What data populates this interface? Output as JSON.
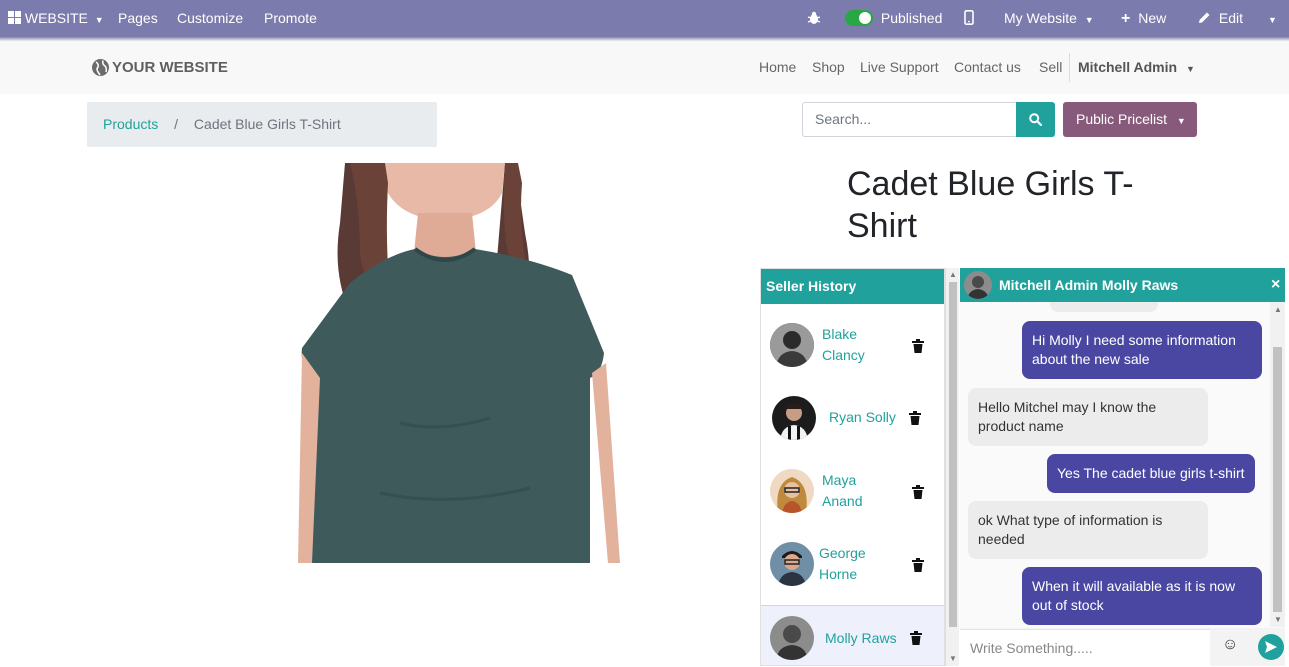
{
  "topbar": {
    "apps_label": "WEBSITE",
    "menu": [
      "Pages",
      "Customize",
      "Promote"
    ],
    "published_label": "Published",
    "website_label": "My Website",
    "new_label": "New",
    "edit_label": "Edit"
  },
  "header": {
    "logo_text": "YOUR WEBSITE",
    "nav": [
      "Home",
      "Shop",
      "Live Support",
      "Contact us",
      "Sell"
    ],
    "user": "Mitchell Admin"
  },
  "breadcrumb": {
    "parent": "Products",
    "separator": "/",
    "current": "Cadet Blue Girls T-Shirt"
  },
  "search": {
    "placeholder": "Search..."
  },
  "pricelist": {
    "label": "Public Pricelist"
  },
  "product": {
    "title": "Cadet Blue Girls T-Shirt"
  },
  "seller_history": {
    "title": "Seller History",
    "sellers": [
      {
        "name": "Blake Clancy"
      },
      {
        "name": "Ryan Solly"
      },
      {
        "name": "Maya Anand"
      },
      {
        "name": "George Horne"
      },
      {
        "name": "Molly Raws"
      }
    ]
  },
  "chat": {
    "title": "Mitchell Admin Molly Raws",
    "close": "×",
    "messages": [
      {
        "from": "me",
        "text": "Hi Molly I need some information about the new sale"
      },
      {
        "from": "them",
        "text": "Hello Mitchel may I know the product name"
      },
      {
        "from": "me",
        "text": "Yes The cadet blue girls t-shirt"
      },
      {
        "from": "them",
        "text": "ok What type of information is needed"
      },
      {
        "from": "me",
        "text": "When it will available as it is now out of stock"
      }
    ],
    "input_placeholder": "Write Something.....",
    "emoji": "☺"
  },
  "colors": {
    "topbar": "#7c7bad",
    "accent_teal": "#21a19b",
    "pricelist": "#875a7b",
    "outgoing_bubble": "#4a47a3",
    "incoming_bubble": "#ececec"
  }
}
